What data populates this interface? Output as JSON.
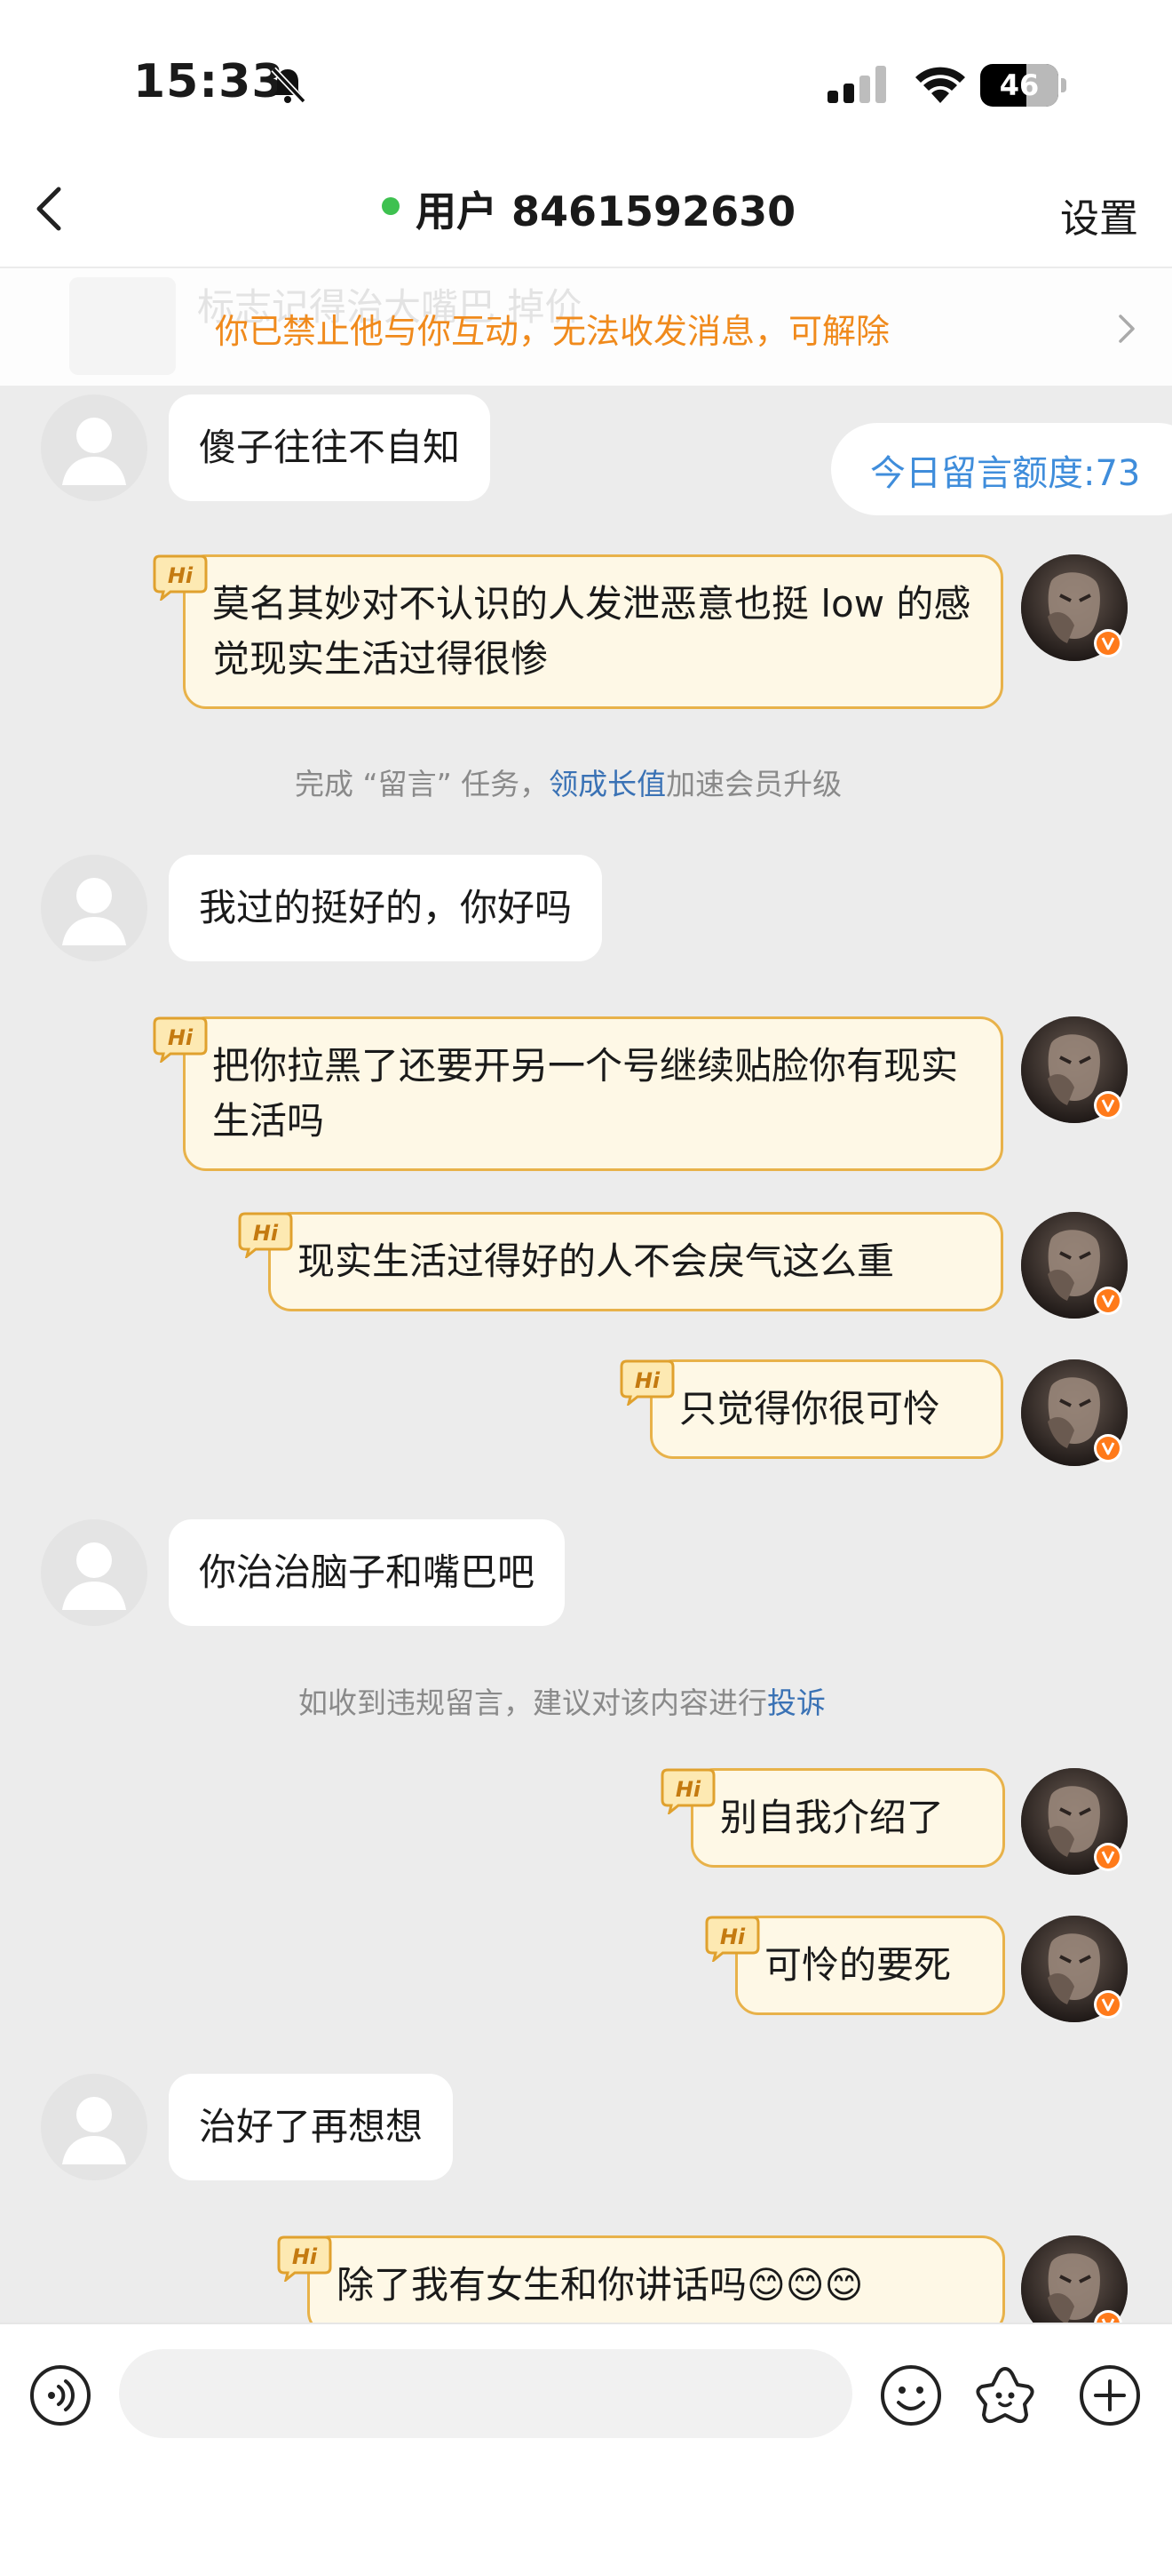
{
  "status_bar": {
    "time": "15:33",
    "battery": "46",
    "icons": [
      "bell-slash-icon",
      "cellular-signal-icon",
      "wifi-icon",
      "battery-icon"
    ]
  },
  "nav": {
    "back_icon": "chevron-left-icon",
    "title": "用户 8461592630",
    "online": true,
    "settings_label": "设置"
  },
  "banner": {
    "ghost_text": "标志记得治大嘴巴   掉价",
    "text": "你已禁止他与你互动，无法收发消息，可解除",
    "arrow_icon": "chevron-right-icon"
  },
  "quota": {
    "text": "今日留言额度:73"
  },
  "messages": [
    {
      "side": "left",
      "text": "傻子往往不自知"
    },
    {
      "side": "right",
      "text": "莫名其妙对不认识的人发泄恶意也挺 low 的感觉现实生活过得很惨"
    },
    {
      "type": "system",
      "pre": "完成 “留言” 任务，",
      "link": "领成长值",
      "post": "加速会员升级"
    },
    {
      "side": "left",
      "text": "我过的挺好的，你好吗"
    },
    {
      "side": "right",
      "text": "把你拉黑了还要开另一个号继续贴脸你有现实生活吗"
    },
    {
      "side": "right",
      "text": "现实生活过得好的人不会戾气这么重"
    },
    {
      "side": "right",
      "text": "只觉得你很可怜"
    },
    {
      "side": "left",
      "text": "你治治脑子和嘴巴吧"
    },
    {
      "type": "system",
      "pre": "如收到违规留言，建议对该内容进行",
      "link": "投诉",
      "post": ""
    },
    {
      "side": "right",
      "text": "别自我介绍了"
    },
    {
      "side": "right",
      "text": "可怜的要死"
    },
    {
      "side": "left",
      "text": "治好了再想想"
    },
    {
      "side": "right",
      "text": "除了我有女生和你讲话吗😊😊😊"
    }
  ],
  "badge": {
    "hi_label": "Hi",
    "verified_label": "V"
  },
  "bottom_bar": {
    "placeholder": "",
    "icons": [
      "voice-icon",
      "emoji-icon",
      "sticker-icon",
      "plus-icon"
    ]
  },
  "colors": {
    "accent_orange": "#f08a1c",
    "link_blue": "#3f8ddb",
    "bubble_right_bg": "#fef8e6",
    "bubble_right_border": "#e8b24a",
    "online_green": "#3ec150"
  }
}
